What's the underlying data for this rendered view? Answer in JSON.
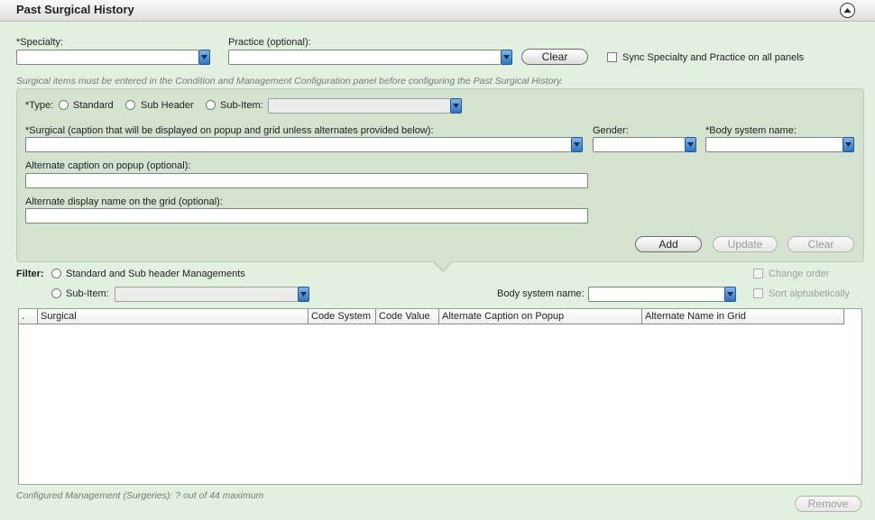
{
  "header": {
    "title": "Past Surgical History"
  },
  "top": {
    "specialty_label": "*Specialty:",
    "practice_label": "Practice (optional):",
    "clear_label": "Clear",
    "sync_label": "Sync Specialty and Practice on all panels",
    "hint": "Surgical items  must be entered in the Condition and Management Configuration panel before configuring the Past Surgical History."
  },
  "panel": {
    "type_label": "*Type:",
    "type_options": [
      "Standard",
      "Sub Header",
      "Sub-Item:"
    ],
    "surgical_label": "*Surgical (caption that will be displayed on popup and grid unless alternates provided below):",
    "gender_label": "Gender:",
    "body_system_label": "*Body system name:",
    "alt_popup_label": "Alternate caption on popup (optional):",
    "alt_grid_label": "Alternate display name on the grid (optional):",
    "add_label": "Add",
    "update_label": "Update",
    "clear_label": "Clear"
  },
  "filter": {
    "label": "Filter:",
    "option_standard": "Standard and Sub header Managements",
    "option_subitem": "Sub-Item:",
    "body_system_label": "Body system name:",
    "change_order_label": "Change order",
    "sort_label": "Sort alphabetically"
  },
  "grid": {
    "columns": [
      ".",
      "Surgical",
      "Code System",
      "Code Value",
      "Alternate Caption on Popup",
      "Alternate Name in Grid"
    ],
    "rows": []
  },
  "footer": {
    "count_text": "Configured Management (Surgeries): ? out of 44 maximum",
    "remove_label": "Remove"
  },
  "colors": {
    "background": "#e2f0e0",
    "panel": "#d3e3d0",
    "dropdown_accent": "#2f74c3"
  }
}
